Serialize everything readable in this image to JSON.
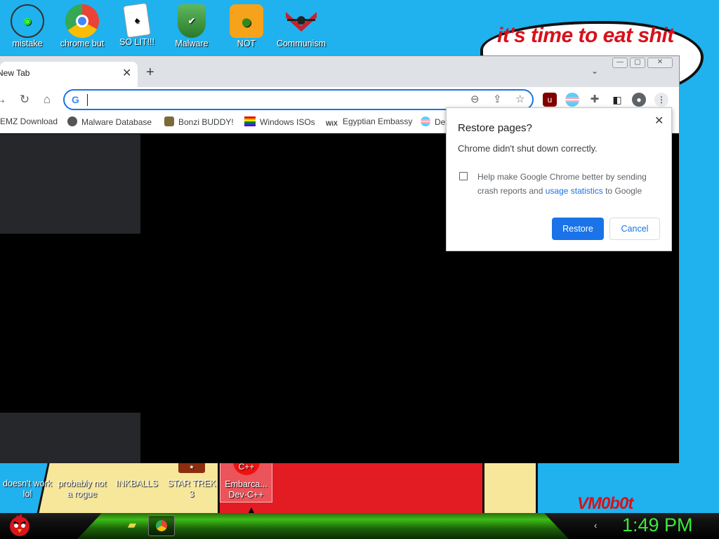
{
  "desktop": {
    "speech_bubble": "it's time to eat shit",
    "signature": "VM0b0t",
    "top_icons": [
      {
        "label": "mistake",
        "icon": "green-globe-icon"
      },
      {
        "label": "chrome but",
        "icon": "chrome-icon"
      },
      {
        "label": "SO LIT!!!",
        "icon": "solitaire-cards-icon"
      },
      {
        "label": "Malware",
        "icon": "shield-check-icon"
      },
      {
        "label": "NOT",
        "icon": "angry-pig-icon"
      },
      {
        "label": "Communism",
        "icon": "flag-emblem-icon"
      }
    ],
    "bottom_icons": [
      {
        "label": "doesn't work lol",
        "icon": "no-sign-icon"
      },
      {
        "label": "probably not a rogue",
        "icon": "computer-icon"
      },
      {
        "label": "INKBALLS",
        "icon": "ball-icon"
      },
      {
        "label": "STAR TREK 3",
        "icon": "star-wars-icon"
      },
      {
        "label": "Embarca... Dev-C++",
        "icon": "cpp-icon"
      }
    ]
  },
  "browser": {
    "tab_title": "New Tab",
    "tab_close": "✕",
    "new_tab": "+",
    "tab_search": "⌄",
    "window_controls": {
      "minimize": "—",
      "maximize": "▢",
      "close": "✕"
    },
    "omnibox_value": "",
    "bookmarks": [
      {
        "label": "EMZ Download",
        "icon": "download-icon"
      },
      {
        "label": "Malware Database",
        "icon": "globe-icon"
      },
      {
        "label": "Bonzi BUDDY!",
        "icon": "bonzi-icon"
      },
      {
        "label": "Windows ISOs",
        "icon": "rainbow-flag-icon"
      },
      {
        "label": "Egyptian Embassy",
        "icon": "wix-icon"
      },
      {
        "label": "De",
        "icon": "trans-flag-icon"
      }
    ],
    "wix_text": "WiX"
  },
  "dialog": {
    "title": "Restore pages?",
    "message": "Chrome didn't shut down correctly.",
    "help_text": "Help make Google Chrome better by sending crash reports and ",
    "help_link": "usage statistics",
    "help_suffix": " to Google",
    "restore": "Restore",
    "cancel": "Cancel",
    "close": "✕",
    "checkbox_checked": false
  },
  "taskbar": {
    "clock": "1:49 PM"
  },
  "colors": {
    "desktop_bg": "#1fb2ee",
    "chrome_blue": "#1a73e8",
    "clock_green": "#3bea3b",
    "speech_red": "#d8101a"
  }
}
